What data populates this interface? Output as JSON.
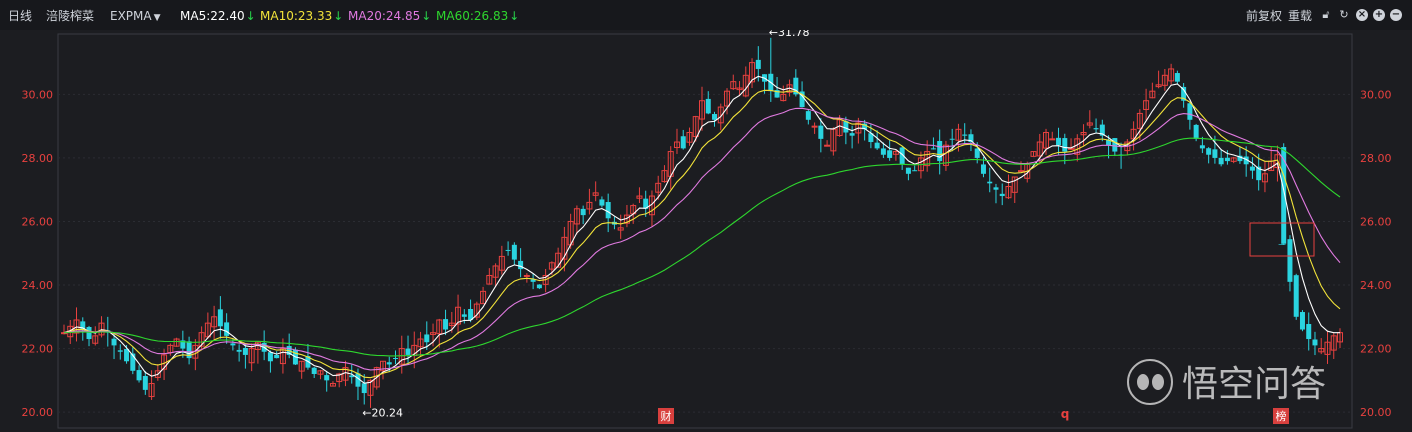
{
  "toolbar": {
    "period": "日线",
    "stock_name": "涪陵榨菜",
    "indicator": "EXPMA",
    "ma": [
      {
        "label": "MA5:",
        "value": "22.40",
        "color": "#ffffff"
      },
      {
        "label": "MA10:",
        "value": "23.33",
        "color": "#f2e33a"
      },
      {
        "label": "MA20:",
        "value": "24.85",
        "color": "#e07ae0"
      },
      {
        "label": "MA60:",
        "value": "26.83",
        "color": "#2ed62e"
      }
    ],
    "down_arrow": "↓",
    "adjust": "前复权",
    "reset": "重载",
    "icons": [
      "lock-icon",
      "refresh-icon",
      "close-icon",
      "zoom-in-icon",
      "zoom-out-icon"
    ]
  },
  "colors": {
    "background": "#1c1d21",
    "up_candle": "#e8413f",
    "down_candle": "#2ad4e0",
    "ma5": "#ffffff",
    "ma10": "#f2e33a",
    "ma20": "#e07ae0",
    "ma60": "#2ed62e",
    "axis_text": "#e8413f"
  },
  "chart_data": {
    "type": "candlestick",
    "ylim": [
      19.5,
      31.9
    ],
    "y_ticks": [
      "20.00",
      "22.00",
      "24.00",
      "26.00",
      "28.00",
      "30.00"
    ],
    "high_label": "←31.78",
    "low_label": "←20.24",
    "high_value": 31.78,
    "low_value": 20.24,
    "high_index": 113,
    "low_index": 48,
    "closes": [
      22.5,
      22.7,
      22.9,
      22.6,
      22.3,
      22.4,
      22.8,
      22.5,
      22.1,
      21.9,
      21.6,
      21.3,
      21.0,
      20.7,
      20.9,
      21.3,
      21.8,
      22.1,
      22.3,
      22.0,
      21.7,
      22.1,
      22.5,
      22.8,
      23.0,
      22.7,
      22.4,
      22.1,
      21.9,
      21.8,
      22.0,
      22.2,
      21.9,
      21.6,
      21.7,
      22.0,
      21.8,
      21.5,
      21.6,
      21.4,
      21.2,
      21.3,
      21.0,
      20.9,
      21.2,
      21.4,
      21.1,
      20.8,
      20.6,
      21.0,
      21.4,
      21.6,
      21.5,
      21.7,
      22.0,
      21.8,
      22.1,
      22.3,
      22.2,
      22.5,
      22.9,
      22.6,
      22.8,
      23.3,
      23.0,
      22.9,
      23.4,
      23.8,
      24.3,
      24.6,
      24.9,
      25.1,
      24.8,
      24.5,
      24.3,
      24.1,
      23.9,
      24.3,
      24.7,
      25.0,
      25.5,
      26.0,
      26.4,
      26.2,
      26.6,
      26.9,
      26.5,
      26.1,
      25.9,
      25.8,
      26.2,
      26.5,
      26.8,
      26.4,
      26.8,
      27.2,
      27.6,
      28.2,
      28.5,
      28.3,
      28.8,
      29.3,
      29.8,
      29.4,
      29.2,
      29.6,
      30.1,
      30.4,
      30.2,
      30.6,
      31.0,
      30.8,
      30.4,
      30.1,
      29.9,
      30.0,
      30.3,
      30.0,
      29.6,
      29.2,
      29.0,
      28.6,
      28.4,
      28.9,
      29.2,
      28.8,
      28.7,
      29.1,
      28.9,
      28.5,
      28.3,
      28.1,
      28.0,
      28.2,
      27.8,
      27.5,
      27.6,
      28.0,
      28.2,
      28.3,
      27.9,
      28.4,
      28.6,
      28.9,
      28.7,
      28.5,
      28.0,
      27.5,
      27.2,
      27.0,
      26.8,
      27.1,
      27.4,
      27.6,
      27.8,
      28.2,
      28.5,
      28.8,
      28.6,
      28.4,
      28.2,
      28.3,
      28.6,
      28.8,
      29.1,
      28.9,
      28.7,
      28.4,
      28.2,
      28.1,
      28.5,
      28.9,
      29.4,
      29.8,
      30.1,
      30.3,
      30.6,
      30.8,
      30.4,
      29.8,
      29.2,
      28.6,
      28.3,
      28.1,
      28.0,
      27.8,
      27.9,
      28.0,
      27.9,
      27.8,
      27.6,
      27.3,
      27.5,
      27.9,
      28.1,
      25.3,
      24.1,
      23.0,
      22.6,
      22.3,
      22.1,
      22.0,
      22.2,
      22.4,
      22.5
    ]
  },
  "annotations": {
    "marker_cai": "财",
    "marker_q": "q",
    "marker_bang": "榜",
    "marker_t": "⊥"
  },
  "watermark": {
    "text": "悟空问答"
  }
}
